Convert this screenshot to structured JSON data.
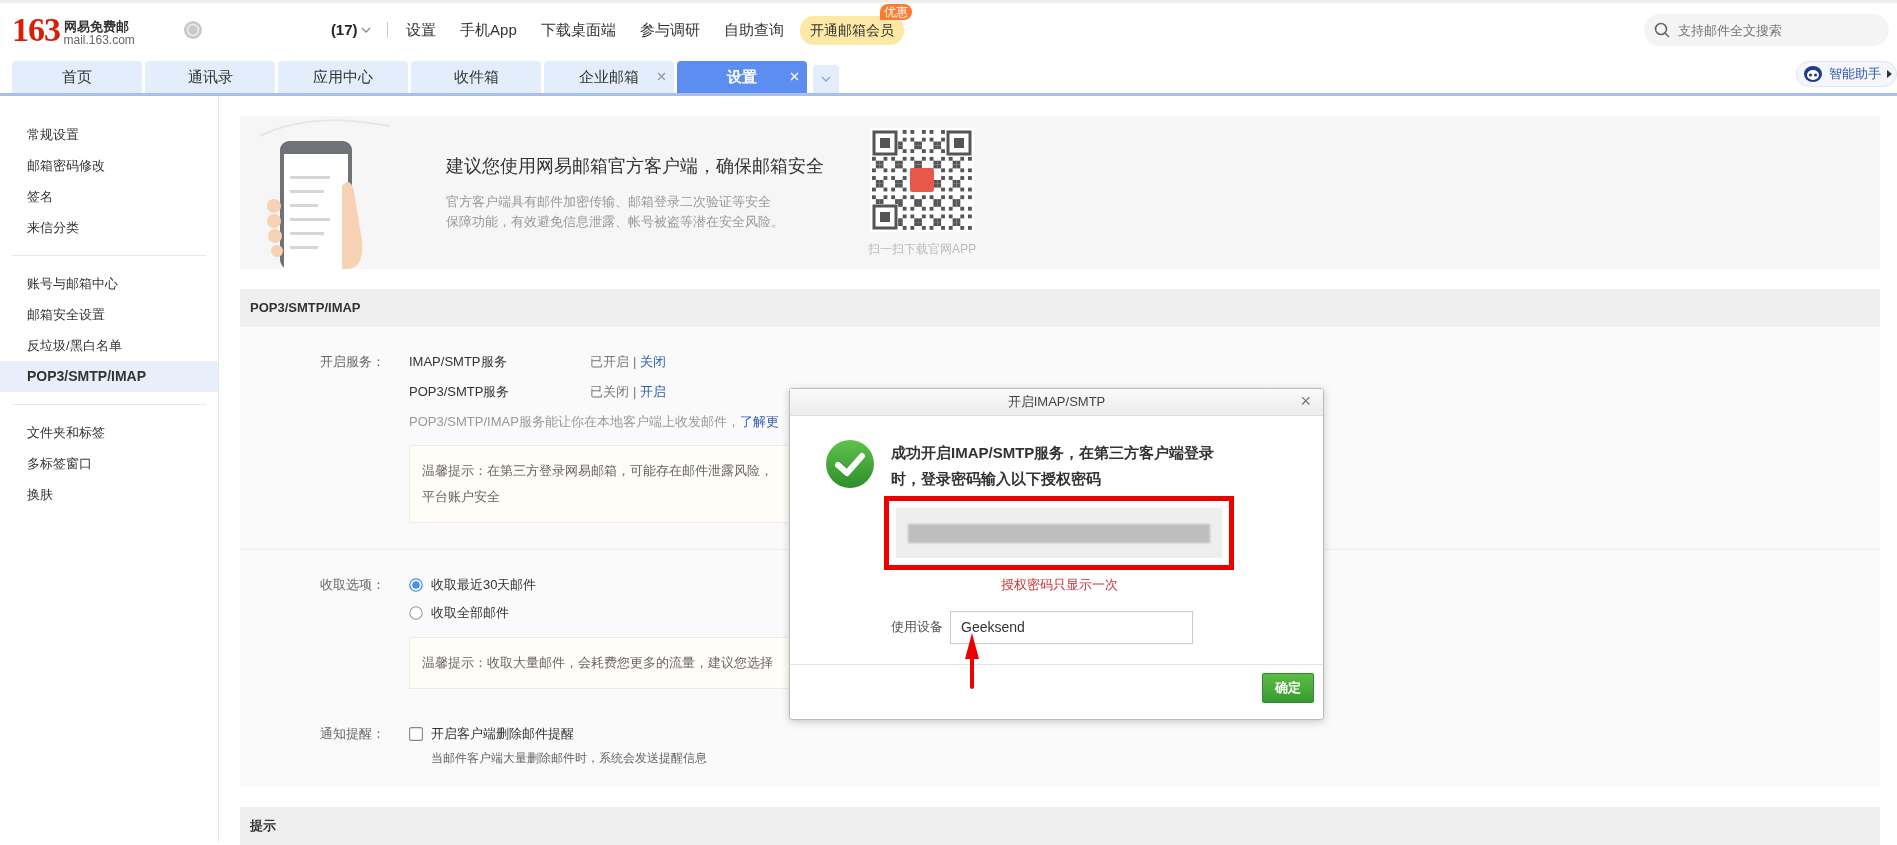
{
  "logo": {
    "number": "163",
    "name": "网易免费邮",
    "domain": "mail.163.com"
  },
  "top_nav": {
    "unread": "(17)",
    "links": [
      "设置",
      "手机App",
      "下载桌面端",
      "参与调研",
      "自助查询"
    ],
    "vip": {
      "label": "开通邮箱会员",
      "badge": "优惠"
    }
  },
  "search": {
    "placeholder": "支持邮件全文搜索"
  },
  "tabs": [
    {
      "label": "首页",
      "selected": false,
      "closable": false
    },
    {
      "label": "通讯录",
      "selected": false,
      "closable": false
    },
    {
      "label": "应用中心",
      "selected": false,
      "closable": false
    },
    {
      "label": "收件箱",
      "selected": false,
      "closable": false
    },
    {
      "label": "企业邮箱",
      "selected": false,
      "closable": true
    },
    {
      "label": "设置",
      "selected": true,
      "closable": true
    }
  ],
  "assistant": {
    "label": "智能助手"
  },
  "sidebar": {
    "groups": [
      [
        {
          "label": "常规设置",
          "selected": false
        },
        {
          "label": "邮箱密码修改",
          "selected": false
        },
        {
          "label": "签名",
          "selected": false
        },
        {
          "label": "来信分类",
          "selected": false
        }
      ],
      [
        {
          "label": "账号与邮箱中心",
          "selected": false
        },
        {
          "label": "邮箱安全设置",
          "selected": false
        },
        {
          "label": "反垃圾/黑白名单",
          "selected": false
        },
        {
          "label": "POP3/SMTP/IMAP",
          "selected": true
        }
      ],
      [
        {
          "label": "文件夹和标签",
          "selected": false
        },
        {
          "label": "多标签窗口",
          "selected": false
        },
        {
          "label": "换肤",
          "selected": false
        }
      ]
    ]
  },
  "banner": {
    "title": "建议您使用网易邮箱官方客户端，确保邮箱安全",
    "description": [
      "官方客户端具有邮件加密传输、邮箱登录二次验证等安全",
      "保障功能，有效避免信息泄露、帐号被盗等潜在安全风险。"
    ],
    "qr_caption": "扫一扫下载官网APP"
  },
  "section": {
    "title": "POP3/SMTP/IMAP"
  },
  "services": {
    "label": "开启服务：",
    "items": [
      {
        "name": "IMAP/SMTP服务",
        "status": "已开启",
        "separator": "|",
        "action": "关闭"
      },
      {
        "name": "POP3/SMTP服务",
        "status": "已关闭",
        "separator": "|",
        "action": "开启"
      }
    ],
    "description": "POP3/SMTP/IMAP服务能让你在本地客户端上收发邮件，",
    "link": "了解更",
    "tip": [
      "温馨提示：在第三方登录网易邮箱，可能存在邮件泄露风险，",
      "平台账户安全"
    ]
  },
  "fetch": {
    "label": "收取选项：",
    "options": [
      {
        "label": "收取最近30天邮件",
        "selected": true
      },
      {
        "label": "收取全部邮件",
        "selected": false
      }
    ],
    "tip": "温馨提示：收取大量邮件，会耗费您更多的流量，建议您选择"
  },
  "notify": {
    "label": "通知提醒：",
    "option": {
      "label": "开启客户端删除邮件提醒",
      "checked": false
    },
    "hint": "当邮件客户端大量删除邮件时，系统会发送提醒信息"
  },
  "next_section": {
    "title": "提示"
  },
  "dialog": {
    "title": "开启IMAP/SMTP",
    "close": "×",
    "message": "成功开启IMAP/SMTP服务，在第三方客户端登录时，登录密码输入以下授权密码",
    "warning": "授权密码只显示一次",
    "device": {
      "label": "使用设备",
      "value": "Geeksend"
    },
    "confirm": "确定"
  }
}
